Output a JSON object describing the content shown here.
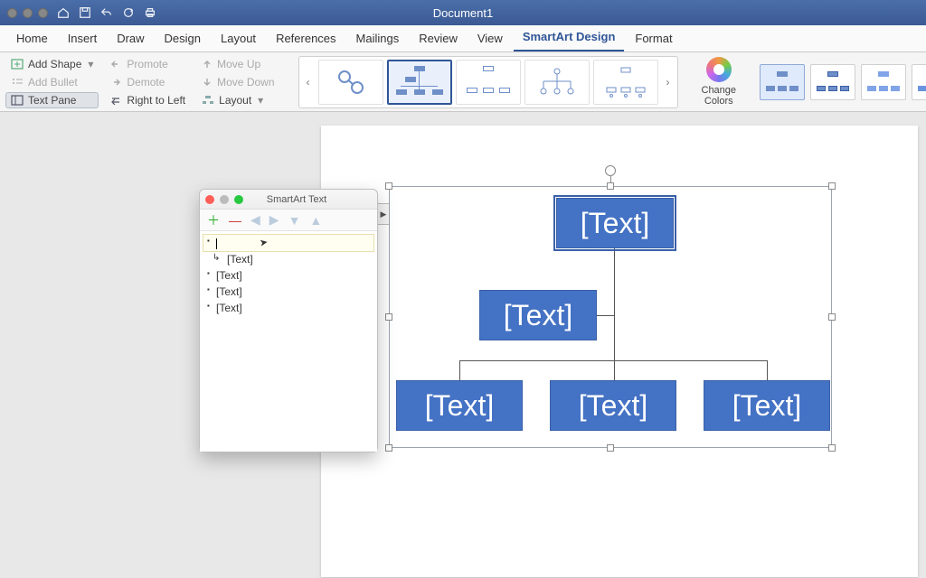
{
  "titlebar": {
    "document_title": "Document1"
  },
  "tabs": {
    "items": [
      "Home",
      "Insert",
      "Draw",
      "Design",
      "Layout",
      "References",
      "Mailings",
      "Review",
      "View",
      "SmartArt Design",
      "Format"
    ],
    "active_index": 9
  },
  "ribbon": {
    "add_shape": "Add Shape",
    "add_bullet": "Add Bullet",
    "text_pane": "Text Pane",
    "promote": "Promote",
    "demote": "Demote",
    "right_to_left": "Right to Left",
    "move_up": "Move Up",
    "move_down": "Move Down",
    "layout": "Layout",
    "change_colors": "Change\nColors"
  },
  "textpane": {
    "title": "SmartArt Text",
    "rows": [
      {
        "text": "",
        "indent": false,
        "active": true
      },
      {
        "text": "[Text]",
        "indent": true,
        "active": false
      },
      {
        "text": "[Text]",
        "indent": false,
        "active": false
      },
      {
        "text": "[Text]",
        "indent": false,
        "active": false
      },
      {
        "text": "[Text]",
        "indent": false,
        "active": false
      }
    ]
  },
  "smartart": {
    "placeholder": "[Text]"
  }
}
